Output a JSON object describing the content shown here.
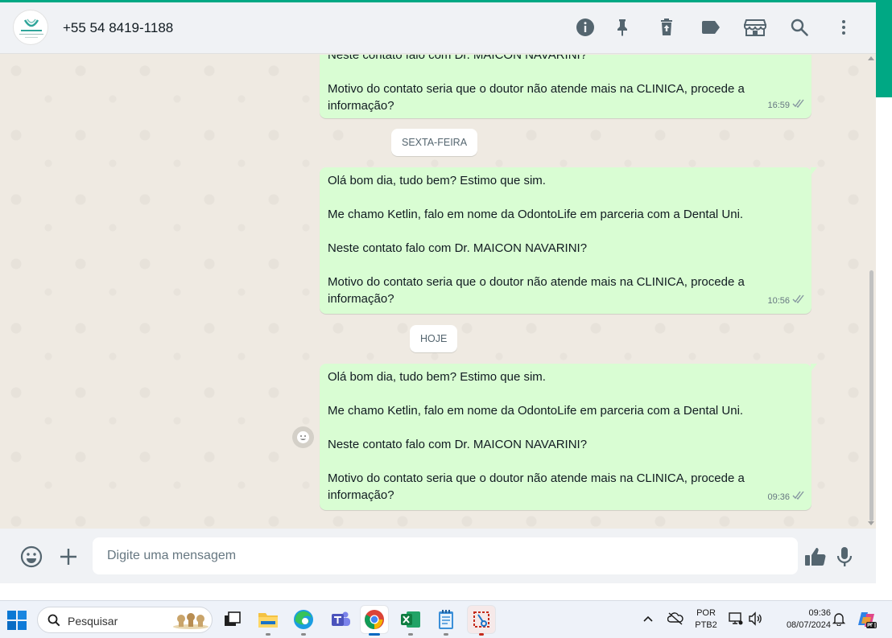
{
  "header": {
    "contact_name": "+55 54 8419-1188",
    "icons": [
      "info-icon",
      "pin-icon",
      "delete-icon",
      "label-icon",
      "catalog-icon",
      "search-icon",
      "menu-icon"
    ]
  },
  "chat": {
    "messages": [
      {
        "lines": [
          "Neste contato falo com Dr. MAICON NAVARINI?",
          "Motivo do contato seria que o doutor não atende mais na CLINICA, procede a informação?"
        ],
        "time": "16:59",
        "status": "read"
      },
      {
        "date_separator": "SEXTA-FEIRA"
      },
      {
        "lines": [
          "Olá bom dia, tudo bem? Estimo que sim.",
          "Me chamo Ketlin, falo em nome da OdontoLife em parceria com a Dental Uni.",
          "Neste contato falo com Dr. MAICON NAVARINI?",
          "Motivo do contato seria que o doutor não atende mais na CLINICA, procede a informação?"
        ],
        "time": "10:56",
        "status": "read"
      },
      {
        "date_separator": "HOJE"
      },
      {
        "lines": [
          "Olá bom dia, tudo bem? Estimo que sim.",
          "Me chamo Ketlin, falo em nome da OdontoLife em parceria com a Dental Uni.",
          "Neste contato falo com Dr. MAICON NAVARINI?",
          "Motivo do contato seria que o doutor não atende mais na CLINICA, procede a informação?"
        ],
        "time": "09:36",
        "status": "read"
      }
    ]
  },
  "composer": {
    "placeholder": "Digite uma mensagem"
  },
  "taskbar": {
    "search_label": "Pesquisar",
    "language": "POR",
    "keyboard": "PTB2",
    "time": "09:36",
    "date": "08/07/2024",
    "apps": [
      "file-explorer",
      "edge",
      "teams",
      "chrome",
      "excel",
      "notepad",
      "snipping-tool"
    ],
    "active_app": "chrome"
  },
  "colors": {
    "accent": "#00a884",
    "outgoing_bubble": "#d9fdd3",
    "chat_background": "#efeae2",
    "header_background": "#f0f2f5"
  }
}
